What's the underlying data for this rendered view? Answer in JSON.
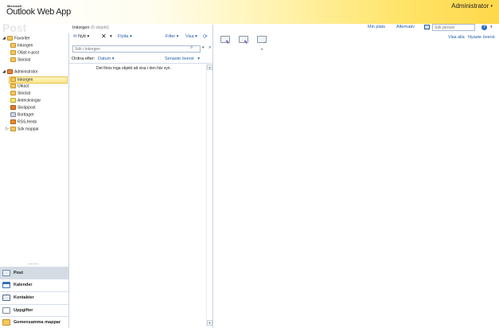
{
  "header": {
    "brand_small": "Microsoft",
    "app_title": "Outlook Web App",
    "user": "Administrator",
    "user_caret": "▾"
  },
  "watermark": "Post",
  "toplinks": {
    "my_site": "Min plats",
    "options": "Alternativ",
    "person_search_placeholder": "Sök person",
    "help": "?",
    "help_caret": "▾"
  },
  "nav": {
    "favorites": {
      "label": "Favoriter",
      "items": [
        "Inkorgen",
        "Oläst e-post",
        "Skickat"
      ]
    },
    "mailbox": {
      "label": "Administrator",
      "items": [
        "Inkorgen",
        "Utkast",
        "Skickat",
        "Anteckningar",
        "Skräppost",
        "Borttaget",
        "RSS-feeds",
        "Sök mappar"
      ]
    },
    "dots": "........",
    "buttons": [
      "Post",
      "Kalender",
      "Kontakter",
      "Uppgifter",
      "Gemensamma mappar"
    ]
  },
  "list": {
    "title": "Inkorgen",
    "count": "(0 objekt)",
    "toolbar": {
      "new_label": "Nytt",
      "delete_caret": "▾",
      "move_label": "Flytta",
      "filter_label": "Filter",
      "view_label": "Visa",
      "caret": "▾"
    },
    "search_placeholder": "Sök i Inkorgen",
    "sort_label": "Ordna efter:",
    "sort_field": "Datum",
    "sort_order": "Senaste överst",
    "empty_message": "Det finns inga objekt att visa i den här vyn."
  },
  "reading": {
    "show_all": "Visa alla",
    "newest_first": "Nyaste överst"
  }
}
